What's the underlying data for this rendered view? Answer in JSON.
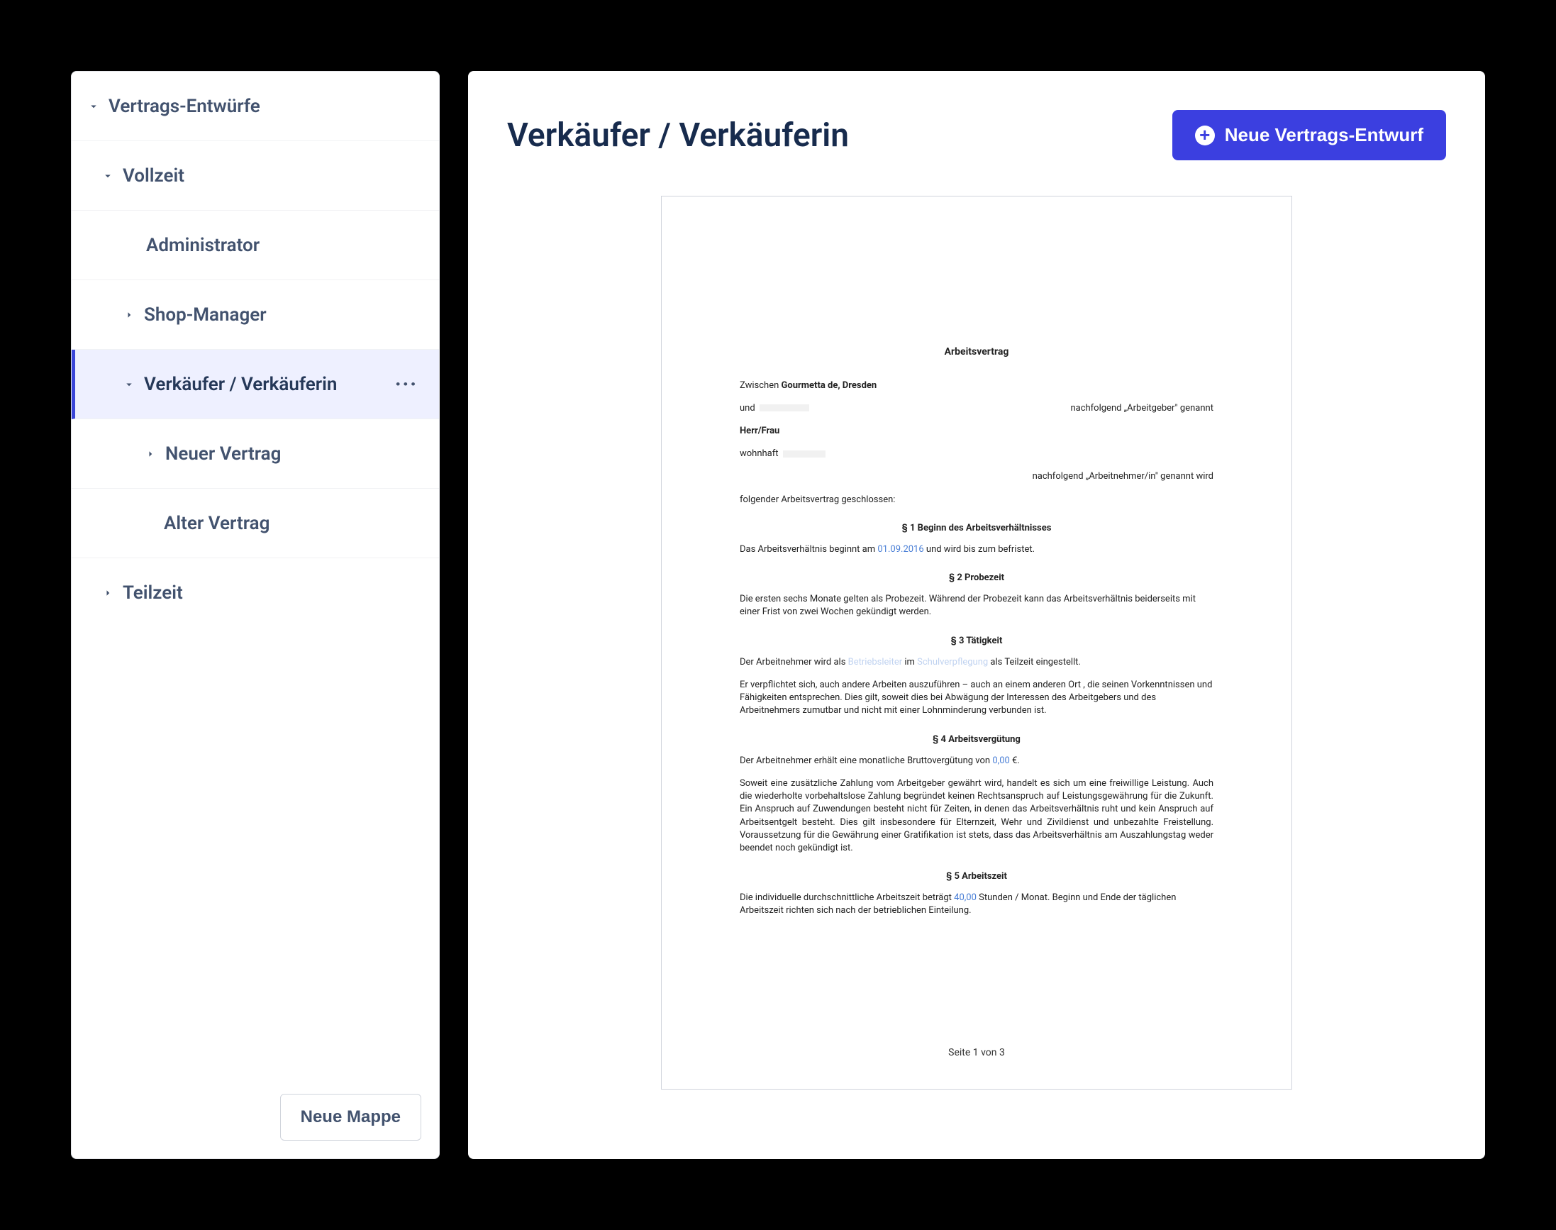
{
  "sidebar": {
    "root_label": "Vertrags-Entwürfe",
    "vollzeit": "Vollzeit",
    "administrator": "Administrator",
    "shop_manager": "Shop-Manager",
    "verkaeufer": "Verkäufer / Verkäuferin",
    "neuer_vertrag": "Neuer Vertrag",
    "alter_vertrag": "Alter Vertrag",
    "teilzeit": "Teilzeit",
    "neue_mappe": "Neue Mappe"
  },
  "main": {
    "title": "Verkäufer / Verkäuferin",
    "new_draft_btn": "Neue Vertrags-Entwurf"
  },
  "doc": {
    "title": "Arbeitsvertrag",
    "between_pre": "Zwischen ",
    "between_company": "Gourmetta de, Dresden",
    "and": "und",
    "employer_suffix": "nachfolgend „Arbeitgeber\" genannt",
    "herr_frau": "Herr/Frau",
    "wohnhaft": "wohnhaft",
    "employee_suffix": "nachfolgend „Arbeitnehmer/in\" genannt wird",
    "closing": "folgender Arbeitsvertrag geschlossen:",
    "s1": "§ 1 Beginn des Arbeitsverhältnisses",
    "s1_text_a": "Das Arbeitsverhältnis beginnt am ",
    "s1_date": "01.09.2016",
    "s1_text_b": " und wird bis zum  befristet.",
    "s2": "§ 2 Probezeit",
    "s2_text": "Die ersten  sechs Monate  gelten als Probezeit. Während der Probezeit kann das Arbeitsverhältnis beiderseits mit einer Frist von zwei Wochen gekündigt werden.",
    "s3": "§ 3 Tätigkeit",
    "s3_text_a": "Der Arbeitnehmer wird als ",
    "s3_role": "Betriebsleiter",
    "s3_text_b": " im ",
    "s3_dept": "Schulverpflegung",
    "s3_text_c": "  als Teilzeit eingestellt.",
    "s3_p2": "Er verpflichtet sich, auch andere Arbeiten auszuführen – auch an einem anderen Ort , die seinen Vorkenntnissen und Fähigkeiten entsprechen. Dies gilt, soweit dies bei Abwägung der Interessen des Arbeitgebers und des Arbeitnehmers zumutbar und nicht mit einer Lohnminderung verbunden ist.",
    "s4": "§ 4 Arbeitsvergütung",
    "s4_text_a": "Der Arbeitnehmer erhält eine monatliche Bruttovergütung von ",
    "s4_amount": "0,00",
    "s4_text_b": " €.",
    "s4_p2": "Soweit eine zusätzliche Zahlung vom Arbeitgeber gewährt wird, handelt es sich um eine freiwillige Leistung. Auch die wiederholte vorbehaltslose Zahlung begründet keinen Rechtsanspruch auf Leistungsgewährung für die Zukunft. Ein Anspruch auf Zuwendungen besteht nicht für Zeiten, in denen das Arbeitsverhältnis ruht und kein Anspruch auf Arbeitsentgelt besteht. Dies gilt insbesondere für Elternzeit, Wehr und Zivildienst und unbezahlte Freistellung. Voraussetzung für die Gewährung einer Gratifikation ist stets, dass das Arbeitsverhältnis am Auszahlungstag weder beendet noch gekündigt ist.",
    "s5": "§ 5 Arbeitszeit",
    "s5_text_a": "Die individuelle durchschnittliche Arbeitszeit beträgt   ",
    "s5_hours": "40,00",
    "s5_text_b": "  Stunden / Monat. Beginn und Ende der täglichen Arbeitszeit richten sich nach der betrieblichen Einteilung.",
    "page_num": "Seite 1 von 3"
  }
}
